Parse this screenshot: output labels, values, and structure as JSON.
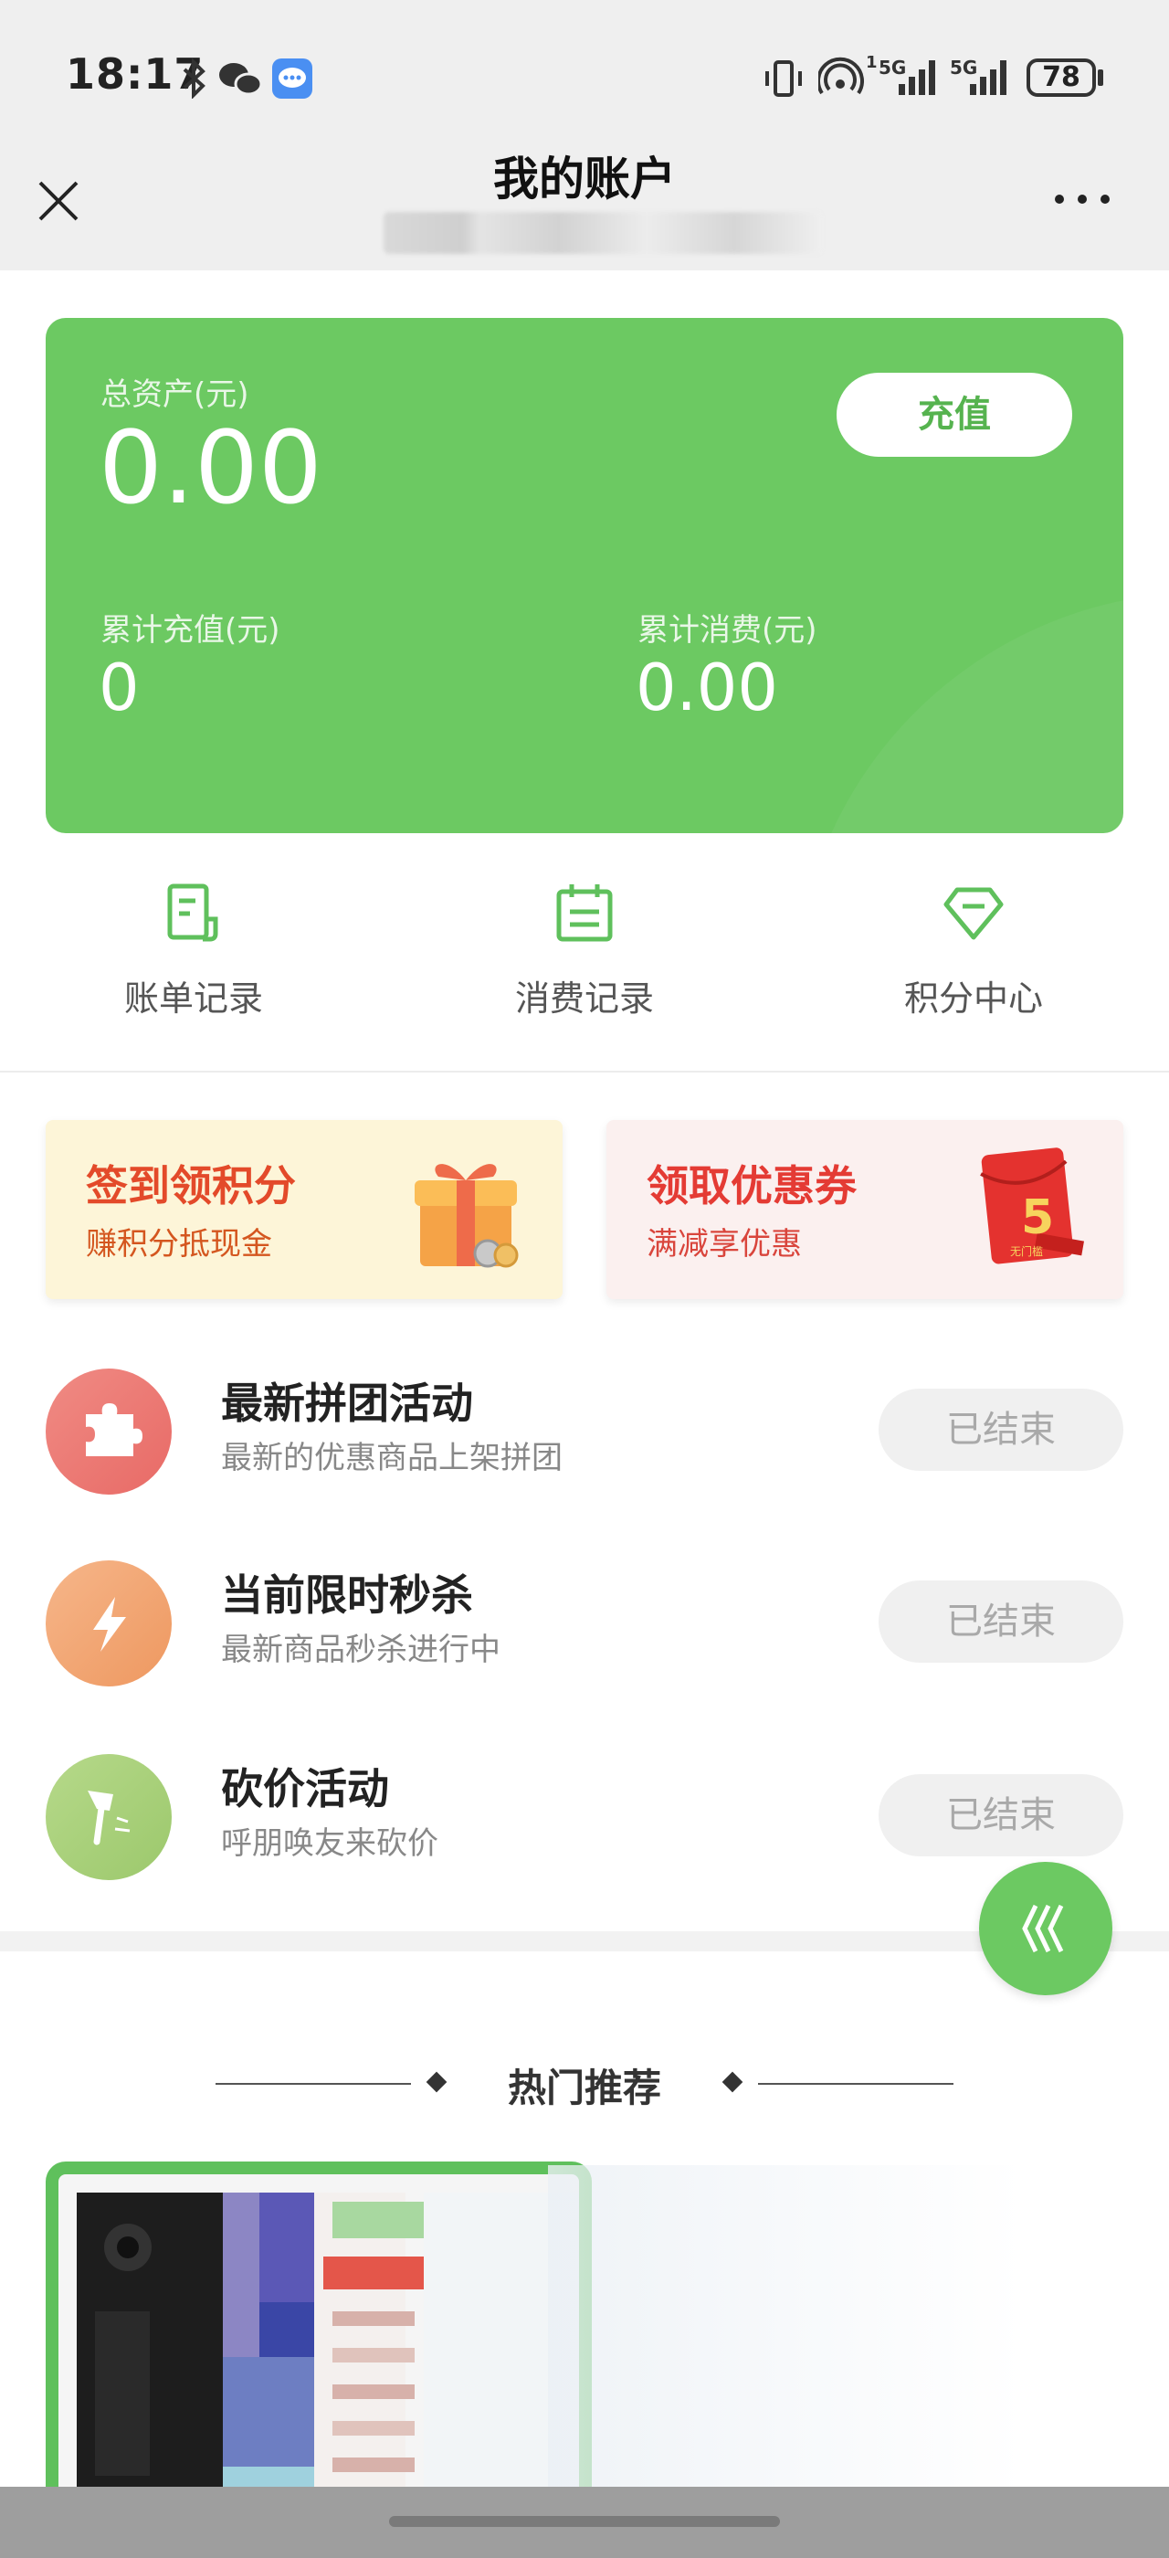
{
  "status_bar": {
    "time": "18:17",
    "battery": "78",
    "network_1": "5G",
    "network_2": "5G",
    "network_sup": "1"
  },
  "header": {
    "title": "我的账户"
  },
  "asset_card": {
    "total_label": "总资产(元)",
    "total_value": "0.00",
    "recharge_label": "充值",
    "cum_recharge_label": "累计充值(元)",
    "cum_recharge_value": "0",
    "cum_spend_label": "累计消费(元)",
    "cum_spend_value": "0.00",
    "color": "#6cc962"
  },
  "quick_nav": [
    {
      "label": "账单记录",
      "icon": "bill-icon"
    },
    {
      "label": "消费记录",
      "icon": "clipboard-icon"
    },
    {
      "label": "积分中心",
      "icon": "diamond-icon"
    }
  ],
  "promos": [
    {
      "title": "签到领积分",
      "subtitle": "赚积分抵现金",
      "icon": "gift-icon"
    },
    {
      "title": "领取优惠券",
      "subtitle": "满减享优惠",
      "icon": "red-envelope-icon",
      "badge": "5",
      "badge_caption": "无门槛"
    }
  ],
  "activities": [
    {
      "title": "最新拼团活动",
      "subtitle": "最新的优惠商品上架拼团",
      "button": "已结束",
      "icon": "puzzle-icon"
    },
    {
      "title": "当前限时秒杀",
      "subtitle": "最新商品秒杀进行中",
      "button": "已结束",
      "icon": "lightning-icon"
    },
    {
      "title": "砍价活动",
      "subtitle": "呼朋唤友来砍价",
      "button": "已结束",
      "icon": "axe-icon"
    }
  ],
  "hot_section": {
    "title": "热门推荐"
  }
}
